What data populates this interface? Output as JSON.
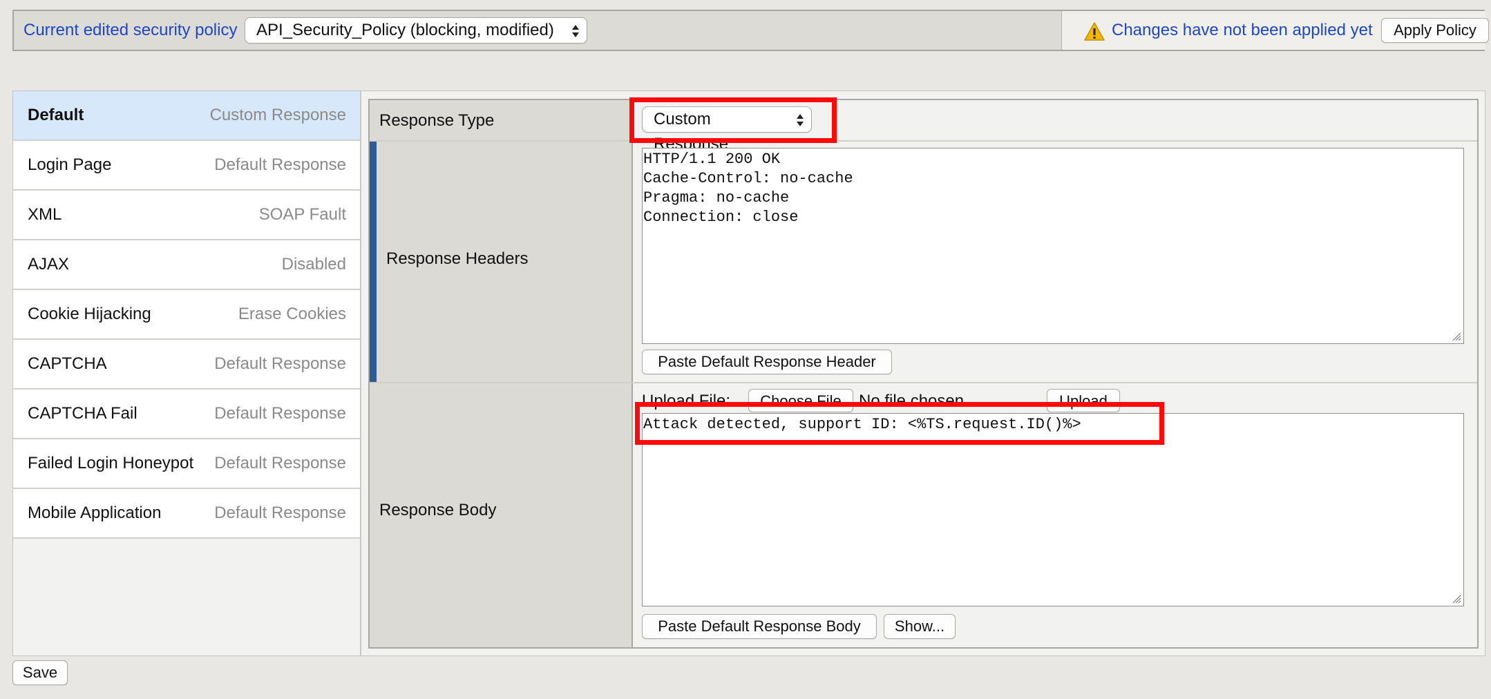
{
  "topbar": {
    "policy_label": "Current edited security policy",
    "policy_select": "API_Security_Policy (blocking, modified)",
    "apply_message": "Changes have not been applied yet",
    "apply_button": "Apply Policy",
    "warning_color": "#f5b800",
    "link_color": "#1d47c4"
  },
  "sidebar": {
    "items": [
      {
        "name": "Default",
        "type": "Custom Response"
      },
      {
        "name": "Login Page",
        "type": "Default Response"
      },
      {
        "name": "XML",
        "type": "SOAP Fault"
      },
      {
        "name": "AJAX",
        "type": "Disabled"
      },
      {
        "name": "Cookie Hijacking",
        "type": "Erase Cookies"
      },
      {
        "name": "CAPTCHA",
        "type": "Default Response"
      },
      {
        "name": "CAPTCHA Fail",
        "type": "Default Response"
      },
      {
        "name": "Failed Login Honeypot",
        "type": "Default Response"
      },
      {
        "name": "Mobile Application",
        "type": "Default Response"
      }
    ]
  },
  "form": {
    "response_type_label": "Response Type",
    "response_type_value": "Custom Response",
    "response_headers_label": "Response Headers",
    "response_headers_value": "HTTP/1.1 200 OK\nCache-Control: no-cache\nPragma: no-cache\nConnection: close",
    "paste_header_button": "Paste Default Response Header",
    "response_body_label": "Response Body",
    "upload_file_label": "Upload File:",
    "choose_file_button": "Choose File",
    "no_file_text": "No file chosen",
    "upload_button": "Upload",
    "response_body_value": "Attack detected, support ID: <%TS.request.ID()%>",
    "paste_body_button": "Paste Default Response Body",
    "show_button": "Show..."
  },
  "save_button": "Save",
  "highlight_color": "#ff0a0a"
}
